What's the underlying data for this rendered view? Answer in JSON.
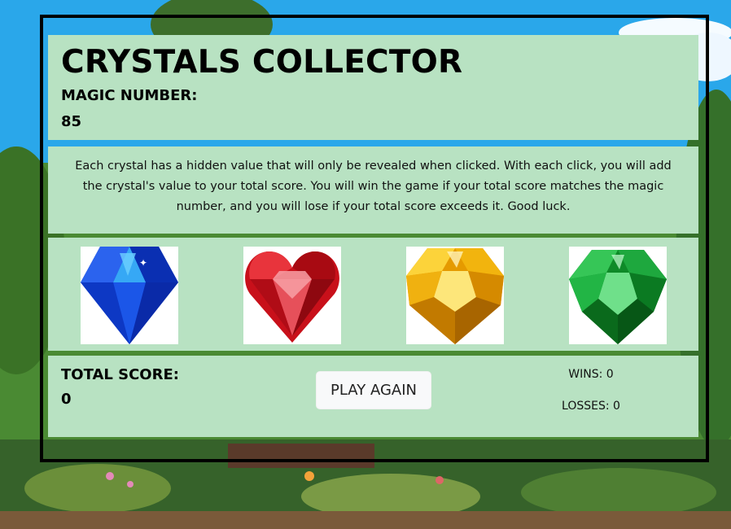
{
  "header": {
    "title": "CRYSTALS COLLECTOR",
    "magic_label": "MAGIC NUMBER:",
    "magic_value": "85"
  },
  "rules": {
    "text": "Each crystal has a hidden value that will only be revealed when clicked. With each click, you will add the crystal's value to your total score. You will win the game if your total score matches the magic number, and you will lose if your total score exceeds it. Good luck."
  },
  "crystals": [
    {
      "icon": "blue-diamond-crystal-icon",
      "color": "#1a4fd8"
    },
    {
      "icon": "red-heart-crystal-icon",
      "color": "#d81a1a"
    },
    {
      "icon": "yellow-crystal-icon",
      "color": "#f2b20a"
    },
    {
      "icon": "green-crystal-icon",
      "color": "#1fa83a"
    }
  ],
  "score": {
    "total_label": "TOTAL SCORE:",
    "total_value": "0",
    "play_again_label": "PLAY AGAIN",
    "wins_label": "WINS: 0",
    "losses_label": "LOSSES: 0"
  },
  "theme": {
    "panel_bg": "#b8e2c2",
    "frame_border": "#000000"
  }
}
